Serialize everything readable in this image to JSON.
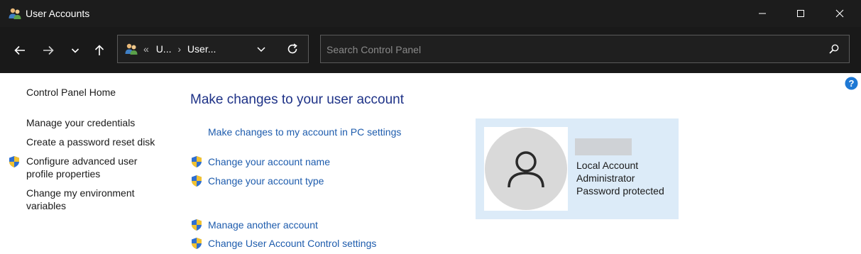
{
  "window": {
    "title": "User Accounts",
    "icon": "user-accounts-icon"
  },
  "address_bar": {
    "crumbs": [
      "U...",
      "User..."
    ],
    "overflow_glyph": "«",
    "separator": "›"
  },
  "search": {
    "placeholder": "Search Control Panel",
    "value": ""
  },
  "left_nav": {
    "home": "Control Panel Home",
    "items": [
      "Manage your credentials",
      "Create a password reset disk",
      "Configure advanced user profile properties",
      "Change my environment variables"
    ]
  },
  "main": {
    "heading": "Make changes to your user account",
    "pc_settings_link": "Make changes to my account in PC settings",
    "links": [
      "Change your account name",
      "Change your account type",
      "Manage another account",
      "Change User Account Control settings"
    ]
  },
  "account": {
    "type": "Local Account",
    "role": "Administrator",
    "status": "Password protected"
  },
  "colors": {
    "titlebar": "#1c1c1c",
    "link_blue": "#1e5cad",
    "heading_blue": "#1e3287",
    "card_bg": "#dcebf8"
  }
}
